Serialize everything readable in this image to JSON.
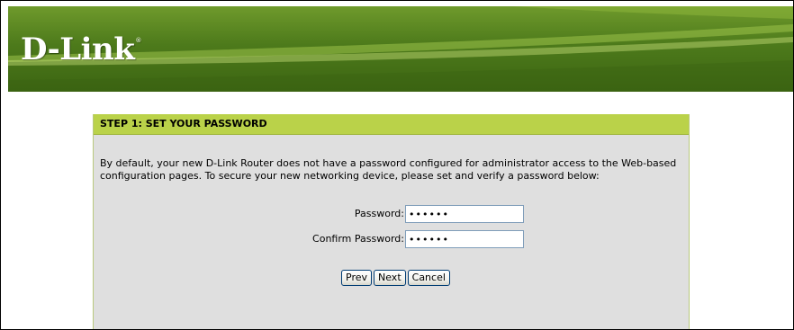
{
  "header": {
    "logo_text": "D-Link",
    "logo_mark": "®",
    "background_color": "#4d7a1b"
  },
  "step": {
    "title": "STEP 1: SET YOUR PASSWORD",
    "title_bg": "#bad249",
    "description": "By default, your new D-Link Router does not have a password configured for administrator access to the Web-based configuration pages. To secure your new networking device, please set and verify a password below:"
  },
  "form": {
    "password_label": "Password:",
    "password_value": "123456",
    "confirm_label": "Confirm Password:",
    "confirm_value": "123456"
  },
  "buttons": {
    "prev": "Prev",
    "next": "Next",
    "cancel": "Cancel"
  }
}
